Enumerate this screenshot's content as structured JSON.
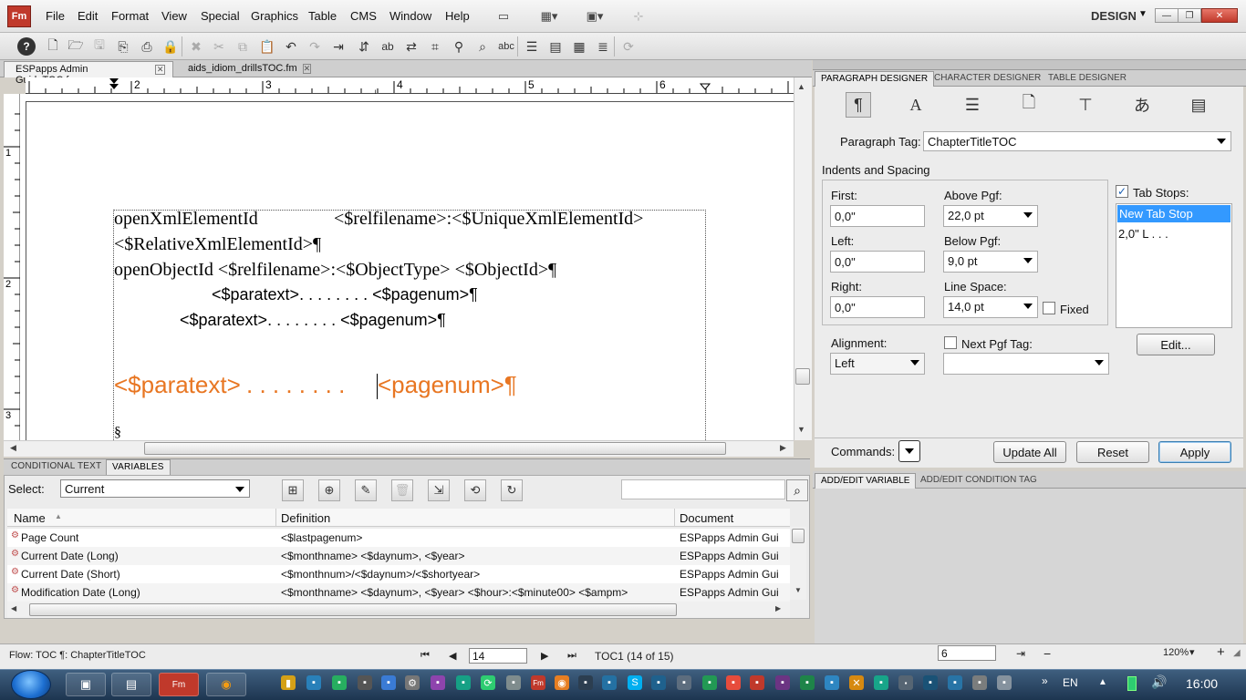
{
  "menubar": {
    "logo": "Fm",
    "items": [
      "File",
      "Edit",
      "Format",
      "View",
      "Special",
      "Graphics",
      "Table",
      "CMS",
      "Window",
      "Help"
    ],
    "workspace": "DESIGN"
  },
  "doc_tabs": [
    "ESPapps Admin GuideTOC.fm",
    "aids_idiom_drillsTOC.fm"
  ],
  "ruler": {
    "h_marks": [
      "2",
      "3",
      "4",
      "5",
      "6"
    ],
    "v_marks": [
      "1",
      "2",
      "3"
    ]
  },
  "document": {
    "lines": [
      {
        "a": "openXmlElementId",
        "b": "<$relfilename>:<$UniqueXmlElementId>"
      },
      {
        "a": "<$RelativeXmlElementId>¶"
      },
      {
        "a": "openObjectId <$relfilename>:<$ObjectType> <$ObjectId>¶"
      },
      {
        "a": "<$paratext>. . . . . . . . <$pagenum>¶"
      },
      {
        "a": "<$paratext>. . . . . . . .  <$pagenum>¶"
      },
      {
        "a": "<$paratext>",
        "b": " . . . . . . . . ",
        "c": "<pagenum>¶"
      },
      {
        "a": "§"
      }
    ]
  },
  "bottom_panel": {
    "tabs": [
      "CONDITIONAL TEXT",
      "VARIABLES"
    ],
    "select_label": "Select:",
    "select_value": "Current",
    "columns": [
      "Name",
      "Definition",
      "Document"
    ],
    "rows": [
      {
        "name": "Page Count",
        "def": "<$lastpagenum>",
        "doc": "ESPapps Admin Gui"
      },
      {
        "name": "Current Date (Long)",
        "def": "<$monthname> <$daynum>, <$year>",
        "doc": "ESPapps Admin Gui"
      },
      {
        "name": "Current Date (Short)",
        "def": "<$monthnum>/<$daynum>/<$shortyear>",
        "doc": "ESPapps Admin Gui"
      },
      {
        "name": "Modification Date (Long)",
        "def": "<$monthname> <$daynum>, <$year> <$hour>:<$minute00> <$ampm>",
        "doc": "ESPapps Admin Gui"
      }
    ]
  },
  "right_panel": {
    "tabs": [
      "PARAGRAPH DESIGNER",
      "CHARACTER DESIGNER",
      "TABLE DESIGNER"
    ],
    "para_tag_label": "Paragraph Tag:",
    "para_tag_value": "ChapterTitleTOC",
    "indents_title": "Indents and Spacing",
    "first_label": "First:",
    "first_value": "0,0\"",
    "left_label": "Left:",
    "left_value": "0,0\"",
    "right_label": "Right:",
    "right_value": "0,0\"",
    "above_label": "Above Pgf:",
    "above_value": "22,0 pt",
    "below_label": "Below Pgf:",
    "below_value": "9,0 pt",
    "linespace_label": "Line Space:",
    "linespace_value": "14,0 pt",
    "fixed_label": "Fixed",
    "tabstops_label": "Tab Stops:",
    "tabstops_items": [
      "New Tab Stop",
      "2,0\"  L  . . ."
    ],
    "alignment_label": "Alignment:",
    "alignment_value": "Left",
    "nextpgf_label": "Next Pgf Tag:",
    "edit_button": "Edit...",
    "commands_label": "Commands:",
    "update_all": "Update All",
    "reset": "Reset",
    "apply": "Apply",
    "lower_tabs": [
      "ADD/EDIT VARIABLE",
      "ADD/EDIT CONDITION TAG"
    ]
  },
  "status": {
    "flow": "Flow: TOC  ¶: ChapterTitleTOC",
    "page": "14",
    "page_info": "TOC1 (14 of 15)",
    "zoom_field": "6",
    "zoom": "120%"
  },
  "taskbar": {
    "lang": "EN",
    "clock": "16:00"
  }
}
